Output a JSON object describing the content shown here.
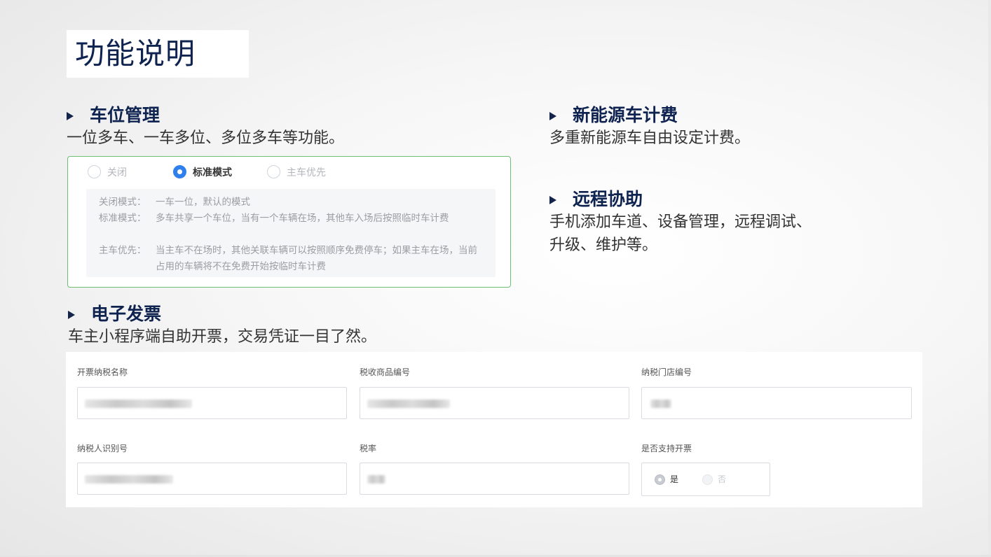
{
  "title": "功能说明",
  "features": {
    "parking": {
      "heading": "车位管理",
      "desc": "一位多车、一车多位、多位多车等功能。"
    },
    "new_energy": {
      "heading": "新能源车计费",
      "desc": "多重新能源车自由设定计费。"
    },
    "remote": {
      "heading": "远程协助",
      "desc": "手机添加车道、设备管理，远程调试、\n升级、维护等。"
    },
    "invoice": {
      "heading": "电子发票",
      "desc": "车主小程序端自助开票，交易凭证一目了然。"
    }
  },
  "parking_panel": {
    "options": [
      {
        "label": "关闭",
        "checked": false
      },
      {
        "label": "标准模式",
        "checked": true
      },
      {
        "label": "主车优先",
        "checked": false
      }
    ],
    "modes": [
      {
        "key": "关闭模式：",
        "value": "一车一位，默认的模式"
      },
      {
        "key": "标准模式：",
        "value": "多车共享一个车位，当有一个车辆在场，其他车入场后按照临时车计费"
      },
      {
        "key": "主车优先：",
        "value": "当主车不在场时，其他关联车辆可以按照顺序免费停车；如果主车在场，当前占用的车辆将不在免费开始按临时车计费"
      }
    ]
  },
  "invoice_form": {
    "fields": {
      "name": "开票纳税名称",
      "goods_code": "税收商品编号",
      "store_code": "纳税门店编号",
      "taxpayer_id": "纳税人识别号",
      "tax_rate": "税率",
      "support": "是否支持开票"
    },
    "support_yes": "是",
    "support_no": "否"
  },
  "colors": {
    "heading": "#0f2350",
    "panel_border": "#6cbf73",
    "radio_checked": "#2f80ed"
  }
}
